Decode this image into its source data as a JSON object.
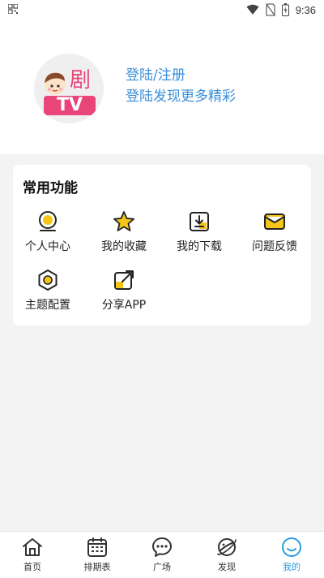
{
  "status_bar": {
    "time": "9:36",
    "icons": [
      "qr-icon",
      "wifi-icon",
      "no-sim-icon",
      "battery-icon"
    ]
  },
  "app": {
    "logo_text": "剧",
    "logo_badge": "TV"
  },
  "login": {
    "line1": "登陆/注册",
    "line2": "登陆发现更多精彩",
    "color": "#3a8fd9"
  },
  "common_functions": {
    "title": "常用功能",
    "items": [
      {
        "label": "个人中心",
        "icon": "profile-icon"
      },
      {
        "label": "我的收藏",
        "icon": "star-icon"
      },
      {
        "label": "我的下载",
        "icon": "download-icon"
      },
      {
        "label": "问题反馈",
        "icon": "mail-icon"
      },
      {
        "label": "主题配置",
        "icon": "theme-icon"
      },
      {
        "label": "分享APP",
        "icon": "share-icon"
      }
    ],
    "accent": "#f5c518"
  },
  "bottom_nav": {
    "items": [
      {
        "label": "首页",
        "icon": "home-icon"
      },
      {
        "label": "排期表",
        "icon": "calendar-icon"
      },
      {
        "label": "广场",
        "icon": "chat-icon"
      },
      {
        "label": "发现",
        "icon": "planet-icon"
      },
      {
        "label": "我的",
        "icon": "smile-icon",
        "active": true
      }
    ],
    "active_color": "#2a9de0"
  }
}
